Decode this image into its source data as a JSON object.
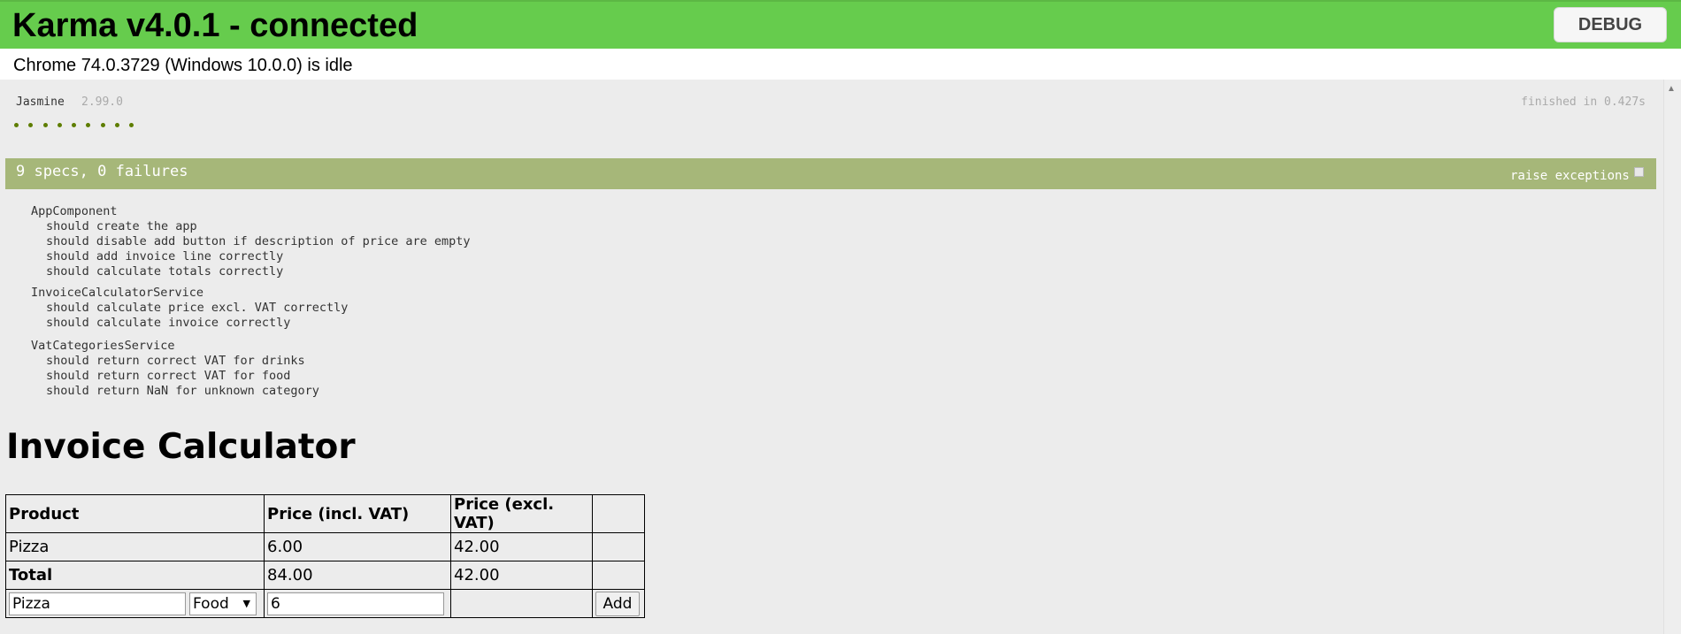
{
  "banner": {
    "title": "Karma v4.0.1 - connected",
    "debug_label": "DEBUG"
  },
  "browser": {
    "status": "Chrome 74.0.3729 (Windows 10.0.0) is idle"
  },
  "jasmine": {
    "name": "Jasmine",
    "version": "2.99.0",
    "finished": "finished in 0.427s",
    "dot_count": 9,
    "summary": "9 specs, 0 failures",
    "raise_exceptions_label": "raise exceptions"
  },
  "suites": [
    {
      "name": "AppComponent",
      "specs": [
        "should create the app",
        "should disable add button if description of price are empty",
        "should add invoice line correctly",
        "should calculate totals correctly"
      ]
    },
    {
      "name": "InvoiceCalculatorService",
      "specs": [
        "should calculate price excl. VAT correctly",
        "should calculate invoice correctly"
      ]
    },
    {
      "name": "VatCategoriesService",
      "specs": [
        "should return correct VAT for drinks",
        "should return correct VAT for food",
        "should return NaN for unknown category"
      ]
    }
  ],
  "app": {
    "heading": "Invoice Calculator",
    "headers": [
      "Product",
      "Price (incl. VAT)",
      "Price (excl. VAT)",
      ""
    ],
    "rows": [
      {
        "product": "Pizza",
        "price_incl": "6.00",
        "price_excl": "42.00"
      }
    ],
    "total": {
      "label": "Total",
      "price_incl": "84.00",
      "price_excl": "42.00"
    },
    "form": {
      "product_value": "Pizza",
      "category_value": "Food",
      "price_value": "6",
      "add_label": "Add"
    }
  },
  "colors": {
    "banner": "#66cc4d",
    "summary_bar": "#a6b779",
    "dot": "#5e7d00",
    "frame_background": "#ececec"
  }
}
